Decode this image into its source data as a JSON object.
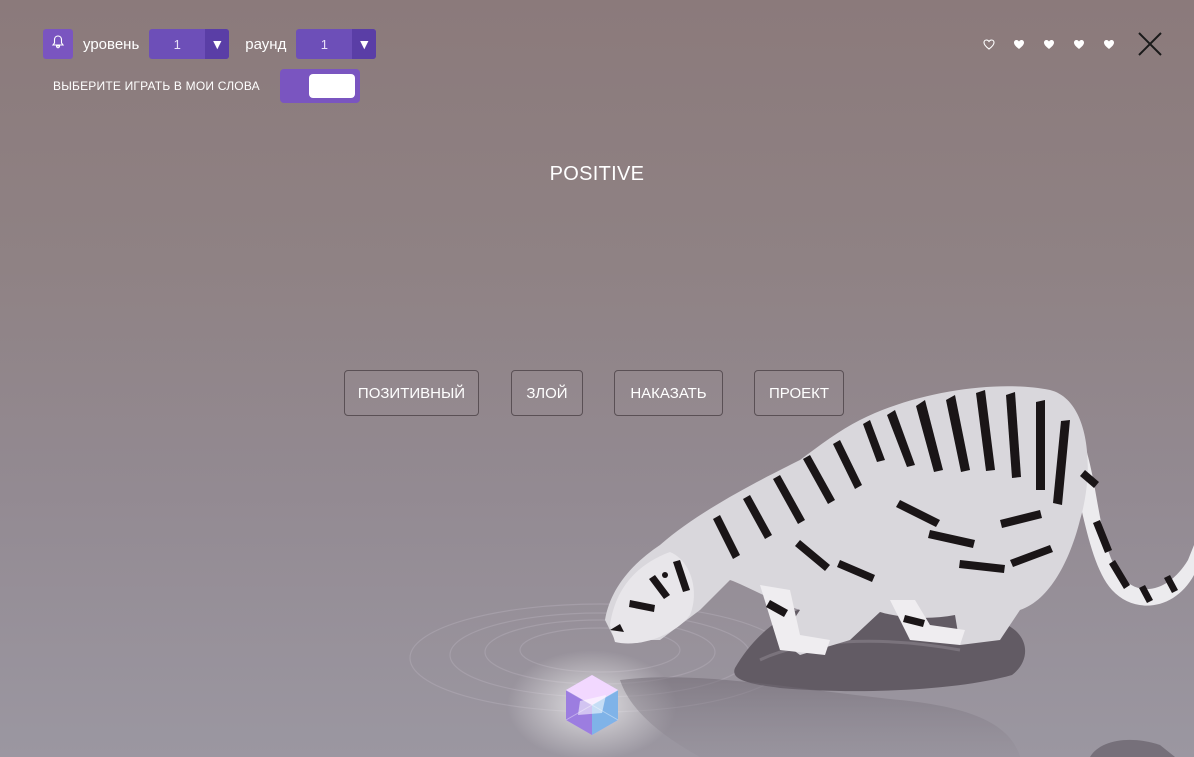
{
  "header": {
    "level_label": "уровень",
    "level_value": "1",
    "round_label": "раунд",
    "round_value": "1",
    "my_words_label": "ВЫБЕРИТЕ ИГРАТЬ В МОИ СЛОВА",
    "my_words_toggle_on": true
  },
  "lives": {
    "total": 5,
    "remaining": 4,
    "hearts": [
      "outline",
      "filled",
      "filled",
      "filled",
      "filled"
    ]
  },
  "question": {
    "word": "POSITIVE"
  },
  "answers": [
    {
      "label": "ПОЗИТИВНЫЙ"
    },
    {
      "label": "ЗЛОЙ"
    },
    {
      "label": "НАКАЗАТЬ"
    },
    {
      "label": "ПРОЕКТ"
    }
  ],
  "colors": {
    "accent": "#7a55c0",
    "accent_dark": "#5a3ea6",
    "button_border": "#5a5055"
  },
  "icons": {
    "bell": "bell-icon",
    "dropdown": "chevron-down-icon",
    "heart": "heart-icon",
    "close": "close-icon"
  }
}
